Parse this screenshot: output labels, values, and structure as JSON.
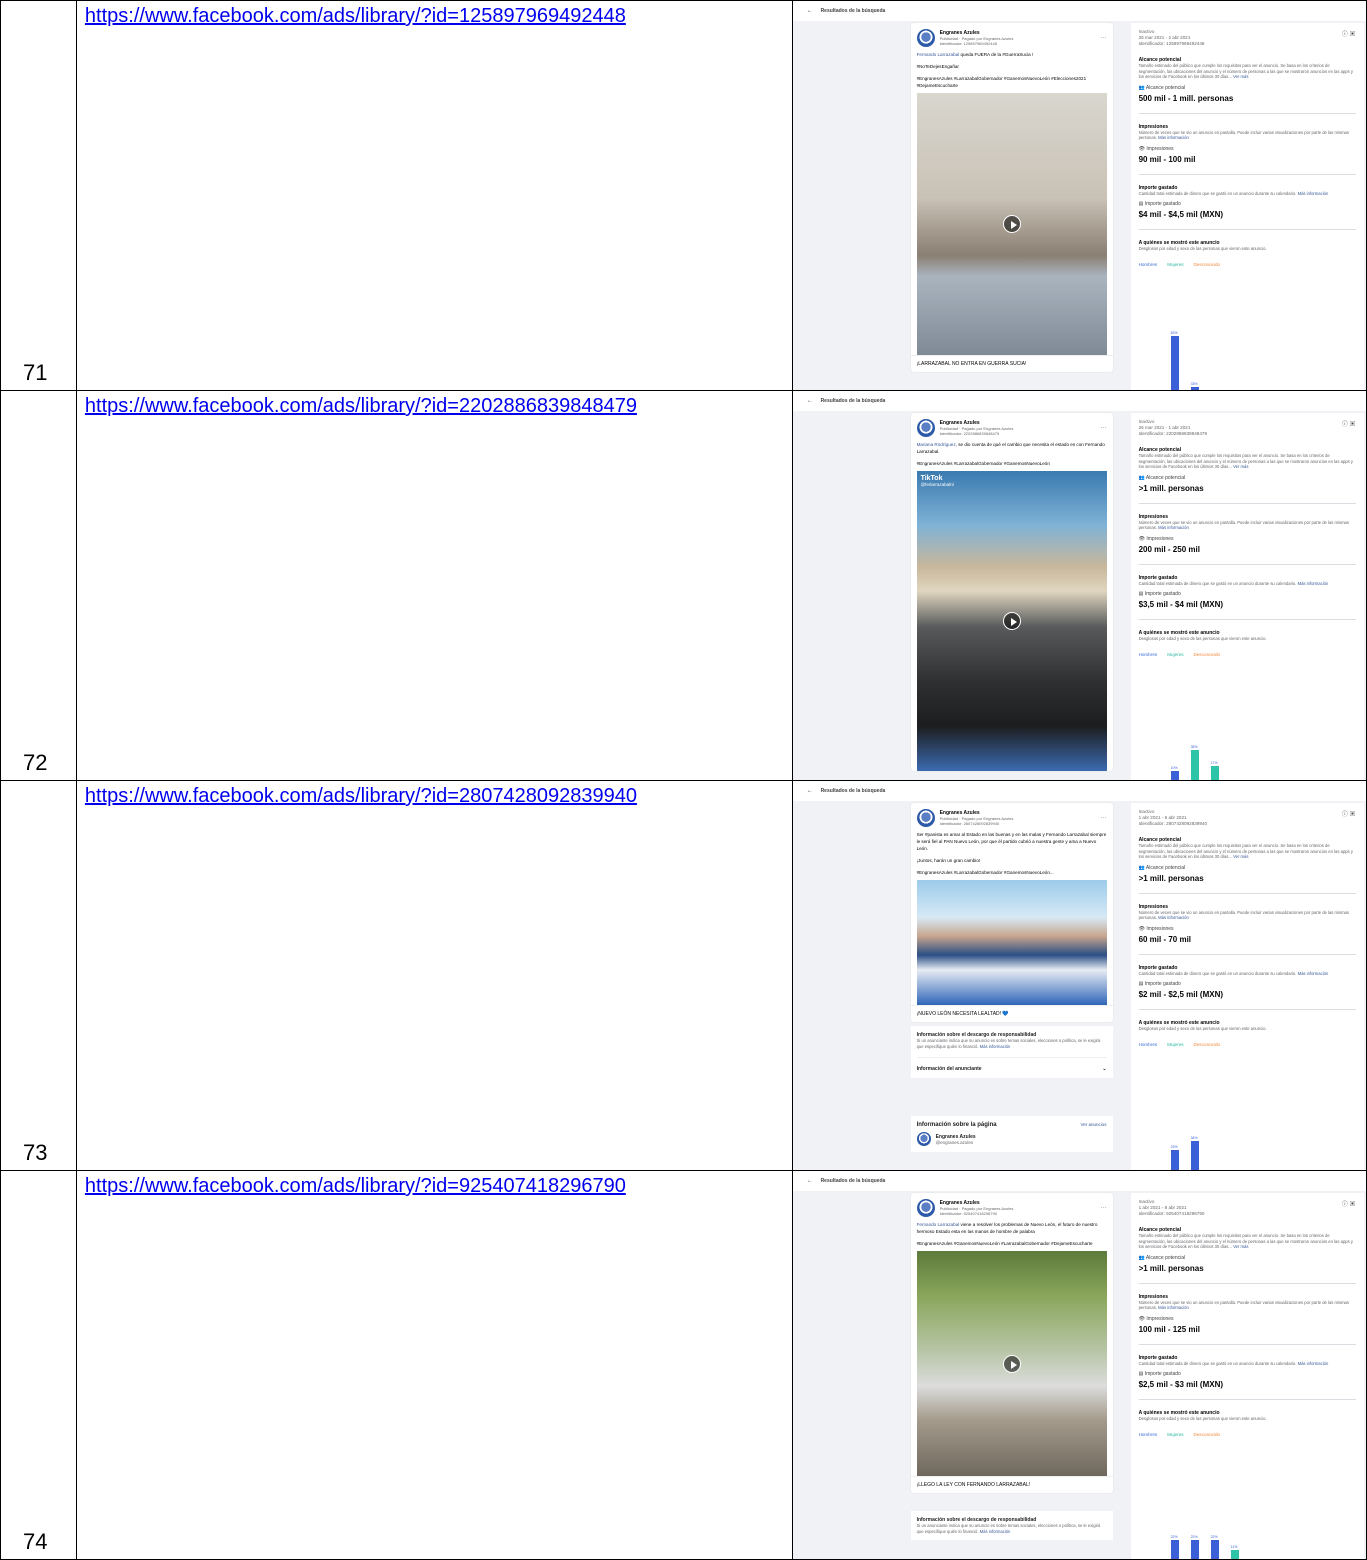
{
  "rows": [
    {
      "num": "71",
      "url": "https://www.facebook.com/ads/library/?id=125897969492448",
      "shot": {
        "back": "Resultados de la búsqueda",
        "advertiser": "Engranes Azules",
        "meta1": "Publicidad · Pagado por Engranes Azules",
        "meta2": "Identificador: 125897969492448",
        "text1_hl": "Fernando Larrazabal",
        "text1": " queda FUERA de la #GuerraSucia !",
        "text2": "#NoTeDejesEngañar",
        "text3": "#EngranesAzules #LarrazabalGobernador #GanemosNuevoLeón #Elecciones2021 #DejameEscucharte",
        "caption": "¡LARRAZABAL NO ENTRA EN GUERRA SUCIA!",
        "status": "Inactivo",
        "dates": "26 mar 2021 - 2 abr 2021",
        "idline": "Identificador: 125897969492448",
        "reach_value": "500 mil - 1 mill. personas",
        "impr_value": "90 mil - 100 mil",
        "spend_value": "$4 mil - $4,5 mil (MXN)",
        "bars": [
          {
            "label": "63%",
            "pct": 63,
            "type": "m"
          },
          {
            "label": "33%",
            "pct": 2,
            "type": "m"
          }
        ]
      }
    },
    {
      "num": "72",
      "url": "https://www.facebook.com/ads/library/?id=2202886839848479",
      "shot": {
        "back": "Resultados de la búsqueda",
        "advertiser": "Engranes Azules",
        "meta1": "Publicidad · Pagado por Engranes Azules",
        "meta2": "Identificador: 2202886839848479",
        "text1_hl": "Mariana Rodríguez",
        "text1": ", se dio cuenta de qué el cambio que necesita el estado es con Fernando Larrazabal.",
        "text2": "#EngranesAzules #LarrazabalGobernador #GanemosNuevoLeón",
        "text3": "",
        "caption": "",
        "tiktok": "TikTok",
        "tiktok_handle": "@ferlarrazabalnl",
        "status": "Inactivo",
        "dates": "26 mar 2021 - 1 abr 2021",
        "idline": "Identificador: 2202886839848479",
        "reach_value": ">1 mill. personas",
        "impr_value": "200 mil - 250 mil",
        "spend_value": "$3,5 mil - $4 mil (MXN)",
        "bars": [
          {
            "label": "10%",
            "pct": 10,
            "type": "m"
          },
          {
            "label": "35%",
            "pct": 35,
            "type": "w"
          },
          {
            "label": "17%",
            "pct": 17,
            "type": "w"
          }
        ]
      }
    },
    {
      "num": "73",
      "url": "https://www.facebook.com/ads/library/?id=2807428092839940",
      "shot": {
        "back": "Resultados de la búsqueda",
        "advertiser": "Engranes Azules",
        "meta1": "Publicidad · Pagado por Engranes Azules",
        "meta2": "Identificador: 2807428092839940",
        "text1_hl": "",
        "text1": "Ser #panista es amar al Estado en las buenas y en las malas y Fernando Larrazabal siempre le será fiel al PAN Nuevo León, por que él partido cubrió a nuestra gente y ama a Nuevo León.",
        "text2": "¡Juntos, harán un gran cambio!",
        "text3": "#EngranesAzules #LarrazabalGobernador #GanemosNuevoLeón...",
        "caption": "¡NUEVO LEÓN NECESITA LEALTAD! 💙",
        "disc_title": "Información sobre el descargo de responsabilidad",
        "disc_text": "Si un anunciante indica que su anuncio es sobre temas sociales, elecciones o política, se le exigirá que especifique quién lo financió.",
        "disc_more": "Más información",
        "adv_info": "Información del anunciante",
        "page_info": "Información sobre la página",
        "page_link": "Ver anuncios",
        "page_name": "Engranes Azules",
        "page_handle": "@engranes.azules",
        "status": "Inactivo",
        "dates": "1 abr 2021 - 6 abr 2021",
        "idline": "Identificador: 2807428092839940",
        "reach_value": ">1 mill. personas",
        "impr_value": "60 mil - 70 mil",
        "spend_value": "$2 mil - $2,5 mil (MXN)",
        "bars": [
          {
            "label": "23%",
            "pct": 23,
            "type": "m"
          },
          {
            "label": "34%",
            "pct": 34,
            "type": "m"
          }
        ]
      }
    },
    {
      "num": "74",
      "url": "https://www.facebook.com/ads/library/?id=925407418296790",
      "shot": {
        "back": "Resultados de la búsqueda",
        "advertiser": "Engranes Azules",
        "meta1": "Publicidad · Pagado por Engranes Azules",
        "meta2": "Identificador: 925407418296790",
        "text1_hl": "Fernando Larrazabal",
        "text1": " viene a resolver los problemas de Nuevo León, el futuro de nuestro hermoso Estado esta en las manos de hombre de palabra",
        "text2": "#EngranesAzules #GanemosNuevoLeón #LarrazabalGobernador #DejameEscucharte",
        "text3": "",
        "caption": "¡LLEGO LA LEY CON FERNANDO LARRAZABAL!",
        "disc_title": "Información sobre el descargo de responsabilidad",
        "disc_text": "Si un anunciante indica que su anuncio es sobre temas sociales, elecciones o política, se le exigirá que especifique quién lo financió.",
        "disc_more": "Más información",
        "status": "Inactivo",
        "dates": "1 abr 2021 - 8 abr 2021",
        "idline": "Identificador: 925407418296790",
        "reach_value": ">1 mill. personas",
        "impr_value": "100 mil - 125 mil",
        "spend_value": "$2,5 mil - $3 mil (MXN)",
        "bars": [
          {
            "label": "22%",
            "pct": 22,
            "type": "m"
          },
          {
            "label": "22%",
            "pct": 22,
            "type": "m"
          },
          {
            "label": "22%",
            "pct": 22,
            "type": "m"
          },
          {
            "label": "11%",
            "pct": 11,
            "type": "w"
          }
        ]
      }
    }
  ],
  "labels": {
    "reach_title": "Alcance potencial",
    "reach_desc": "Tamaño estimado del público que cumple los requisitos para ver el anuncio. Se basa en los criterios de segmentación, las ubicaciones del anuncio y el número de personas a las que se mostraron anuncios en las apps y los servicios de Facebook en los últimos 30 días...",
    "reach_more": "Ver más",
    "reach_label": "Alcance potencial",
    "impr_title": "Impresiones",
    "impr_desc": "Número de veces que se vio un anuncio en pantalla. Puede incluir varias visualizaciones por parte de las mismas personas.",
    "more_info": "Más información",
    "impr_label": "Impresiones",
    "spend_title": "Importe gastado",
    "spend_desc": "Cantidad total estimada de dinero que se gastó en un anuncio durante su calendario.",
    "spend_label": "Importe gastado",
    "who_title": "A quiénes se mostró este anuncio",
    "who_desc": "Desglosos por edad y sexo de las personas que vieron este anuncio.",
    "legend_m": "Hombres",
    "legend_w": "Mujeres",
    "legend_u": "Desconocido"
  }
}
